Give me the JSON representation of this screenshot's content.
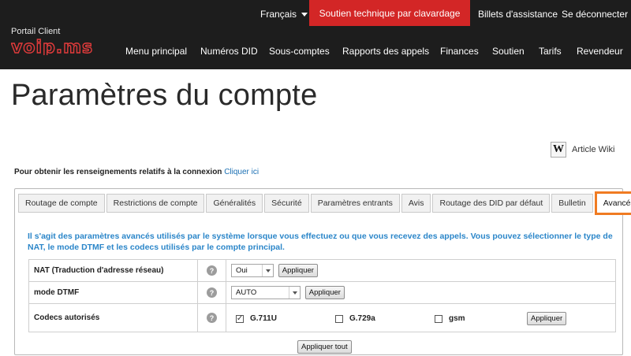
{
  "header": {
    "portal_label": "Portail Client",
    "logo_text": "voip.ms",
    "language": "Français",
    "chat_support": "Soutien technique par clavardage",
    "tickets": "Billets d'assistance",
    "logout": "Se déconnecter",
    "nav": [
      "Menu principal",
      "Numéros DID",
      "Sous-comptes",
      "Rapports des appels",
      "Finances",
      "Soutien",
      "Tarifs",
      "Revendeur"
    ]
  },
  "page": {
    "title": "Paramètres du compte",
    "wiki_icon": "W",
    "wiki_link": "Article Wiki",
    "connection_info": "Pour obtenir les renseignements relatifs à la connexion",
    "connection_link": "Cliquer ici"
  },
  "tabs": [
    "Routage de compte",
    "Restrictions de compte",
    "Généralités",
    "Sécurité",
    "Paramètres entrants",
    "Avis",
    "Routage des DID par défaut",
    "Bulletin",
    "Avancés"
  ],
  "active_tab": "Avancés",
  "advanced": {
    "description": "Il s'agit des paramètres avancés utilisés par le système lorsque vous effectuez ou que vous recevez des appels. Vous pouvez sélectionner le type de NAT, le mode DTMF et les codecs utilisés par le compte principal.",
    "help_glyph": "?",
    "check_glyph": "✓",
    "nat": {
      "label": "NAT (Traduction d'adresse réseau)",
      "value": "Oui",
      "apply": "Appliquer"
    },
    "dtmf": {
      "label": "mode DTMF",
      "value": "AUTO",
      "apply": "Appliquer"
    },
    "codecs": {
      "label": "Codecs autorisés",
      "items": [
        {
          "name": "G.711U",
          "checked": true
        },
        {
          "name": "G.729a",
          "checked": false
        },
        {
          "name": "gsm",
          "checked": false
        }
      ],
      "apply": "Appliquer"
    },
    "apply_all": "Appliquer tout"
  },
  "colors": {
    "header_bg": "#1d1d1d",
    "chat_red": "#d32626",
    "active_tab_border": "#f07b22",
    "description_blue": "#2b86c9",
    "link_blue": "#1a6fb3"
  }
}
